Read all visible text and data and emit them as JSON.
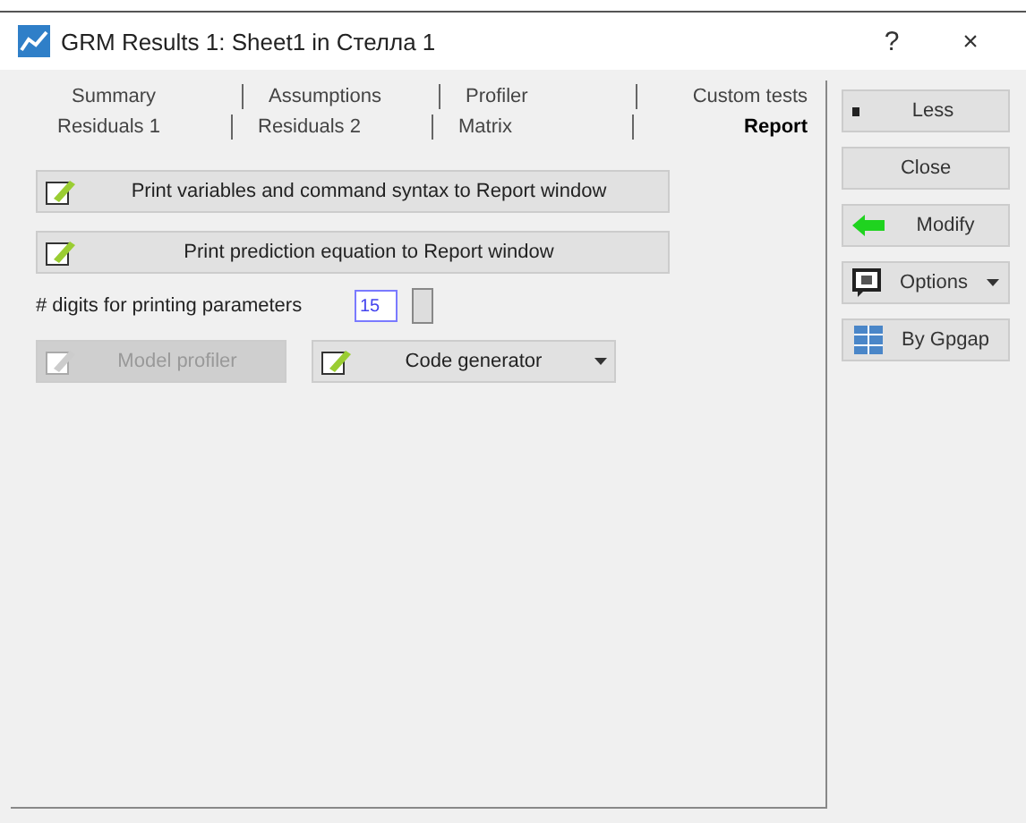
{
  "window": {
    "title": "GRM Results 1: Sheet1 in Стелла 1",
    "help": "?",
    "close": "×"
  },
  "tabs": [
    [
      {
        "label": "Summary",
        "selected": false
      },
      {
        "label": "Assumptions",
        "selected": false
      },
      {
        "label": "Profiler",
        "selected": false
      },
      {
        "label": "Custom tests",
        "selected": false
      }
    ],
    [
      {
        "label": "Residuals 1",
        "selected": false
      },
      {
        "label": "Residuals 2",
        "selected": false
      },
      {
        "label": "Matrix",
        "selected": false
      },
      {
        "label": "Report",
        "selected": true
      }
    ]
  ],
  "actions": [
    {
      "label": "Print variables and command syntax to Report window"
    },
    {
      "label": "Print prediction equation to Report window"
    }
  ],
  "digits": {
    "label": "# digits for printing parameters",
    "value": "15"
  },
  "bottom_buttons": [
    {
      "kind": "plain",
      "label": "Model profiler",
      "disabled": true
    },
    {
      "kind": "dropdown",
      "label": "Code generator",
      "disabled": false
    }
  ],
  "side_buttons": [
    {
      "kind": "less",
      "label": "Less"
    },
    {
      "kind": "plain",
      "label": "Close"
    },
    {
      "kind": "modify",
      "label": "Modify"
    },
    {
      "kind": "options",
      "label": "Options"
    },
    {
      "kind": "group",
      "label": "By Gpgap"
    }
  ]
}
